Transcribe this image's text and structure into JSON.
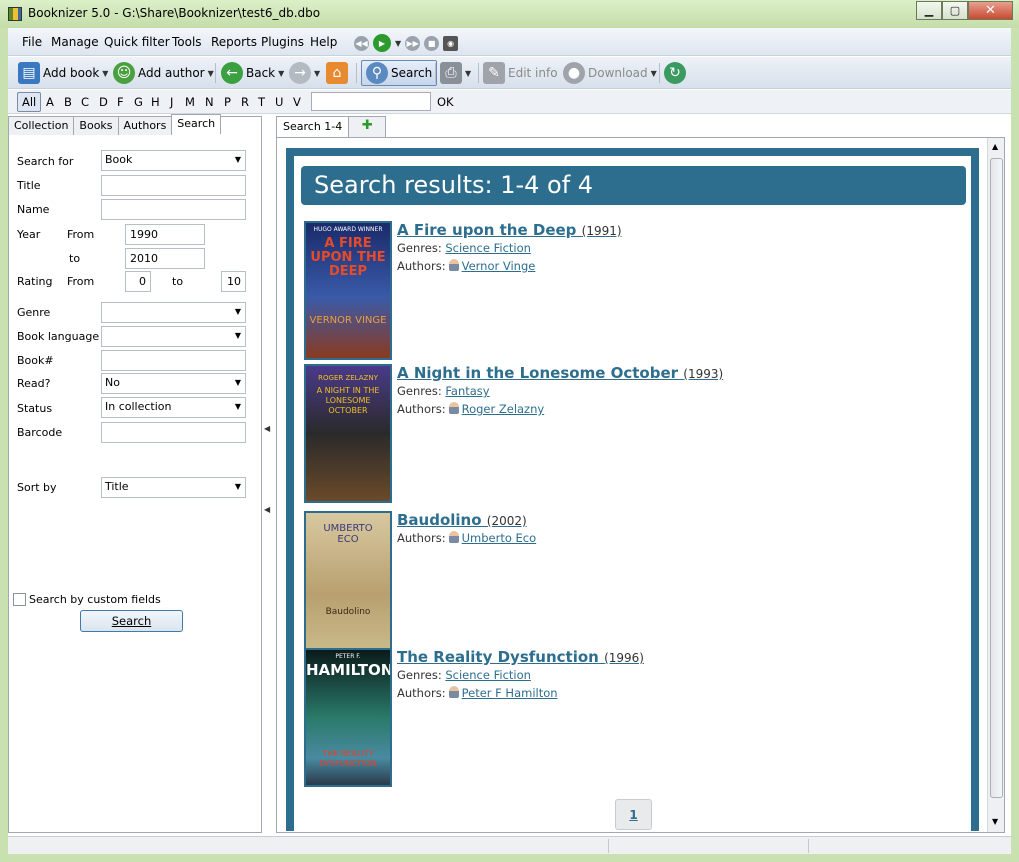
{
  "window": {
    "title": "Booknizer 5.0 - G:\\Share\\Booknizer\\test6_db.dbo"
  },
  "menu": [
    "File",
    "Manage",
    "Quick filter",
    "Tools",
    "Reports",
    "Plugins",
    "Help"
  ],
  "toolbar": {
    "add_book": "Add book",
    "add_author": "Add author",
    "back": "Back",
    "search": "Search",
    "edit_info": "Edit info",
    "download": "Download"
  },
  "alphabet": {
    "all": "All",
    "letters": [
      "A",
      "B",
      "C",
      "D",
      "F",
      "G",
      "H",
      "J",
      "M",
      "N",
      "P",
      "R",
      "T",
      "U",
      "V"
    ],
    "search_value": "",
    "ok": "OK"
  },
  "left_tabs": [
    "Collection",
    "Books",
    "Authors",
    "Search"
  ],
  "search_form": {
    "search_for_label": "Search for",
    "search_for_value": "Book",
    "title_label": "Title",
    "title_value": "",
    "name_label": "Name",
    "name_value": "",
    "year_label": "Year",
    "from_label": "From",
    "to_label": "to",
    "year_from": "1990",
    "year_to": "2010",
    "rating_label": "Rating",
    "rating_from_label": "From",
    "rating_to_label": "to",
    "rating_from": "0",
    "rating_to": "10",
    "genre_label": "Genre",
    "genre_value": "",
    "language_label": "Book language",
    "language_value": "",
    "booknum_label": "Book#",
    "booknum_value": "",
    "read_label": "Read?",
    "read_value": "No",
    "status_label": "Status",
    "status_value": "In collection",
    "barcode_label": "Barcode",
    "barcode_value": "",
    "sort_label": "Sort by",
    "sort_value": "Title",
    "custom_fields_label": "Search by custom fields",
    "search_button": "Search"
  },
  "right_tabs": {
    "active": "Search 1-4",
    "new": "✚"
  },
  "results": {
    "header": "Search results: 1-4 of 4",
    "genres_label": "Genres:",
    "authors_label": "Authors:",
    "books": [
      {
        "title": "A Fire upon the Deep",
        "year": "(1991)",
        "genre": "Science Fiction",
        "author": "Vernor Vinge",
        "cover_top": "HUGO AWARD WINNER",
        "cover_main": "A FIRE UPON THE DEEP",
        "cover_author": "VERNOR VINGE",
        "cover_color": "#2a3a78"
      },
      {
        "title": "A Night in the Lonesome October",
        "year": "(1993)",
        "genre": "Fantasy",
        "author": "Roger Zelazny",
        "cover_top": "ROGER ZELAZNY",
        "cover_main": "A NIGHT IN THE LONESOME OCTOBER",
        "cover_author": "",
        "cover_color": "#3a2a20"
      },
      {
        "title": "Baudolino",
        "year": "(2002)",
        "genre": "",
        "author": "Umberto Eco",
        "cover_top": "UMBERTO ECO",
        "cover_main": "Baudolino",
        "cover_author": "",
        "cover_color": "#c8b890"
      },
      {
        "title": "The Reality Dysfunction",
        "year": "(1996)",
        "genre": "Science Fiction",
        "author": "Peter F Hamilton",
        "cover_top": "PETER F.",
        "cover_main": "HAMILTON",
        "cover_author": "THE REALITY DYSFUNCTION",
        "cover_color": "#1a4a5a"
      }
    ]
  },
  "pagination": {
    "current": "1"
  }
}
